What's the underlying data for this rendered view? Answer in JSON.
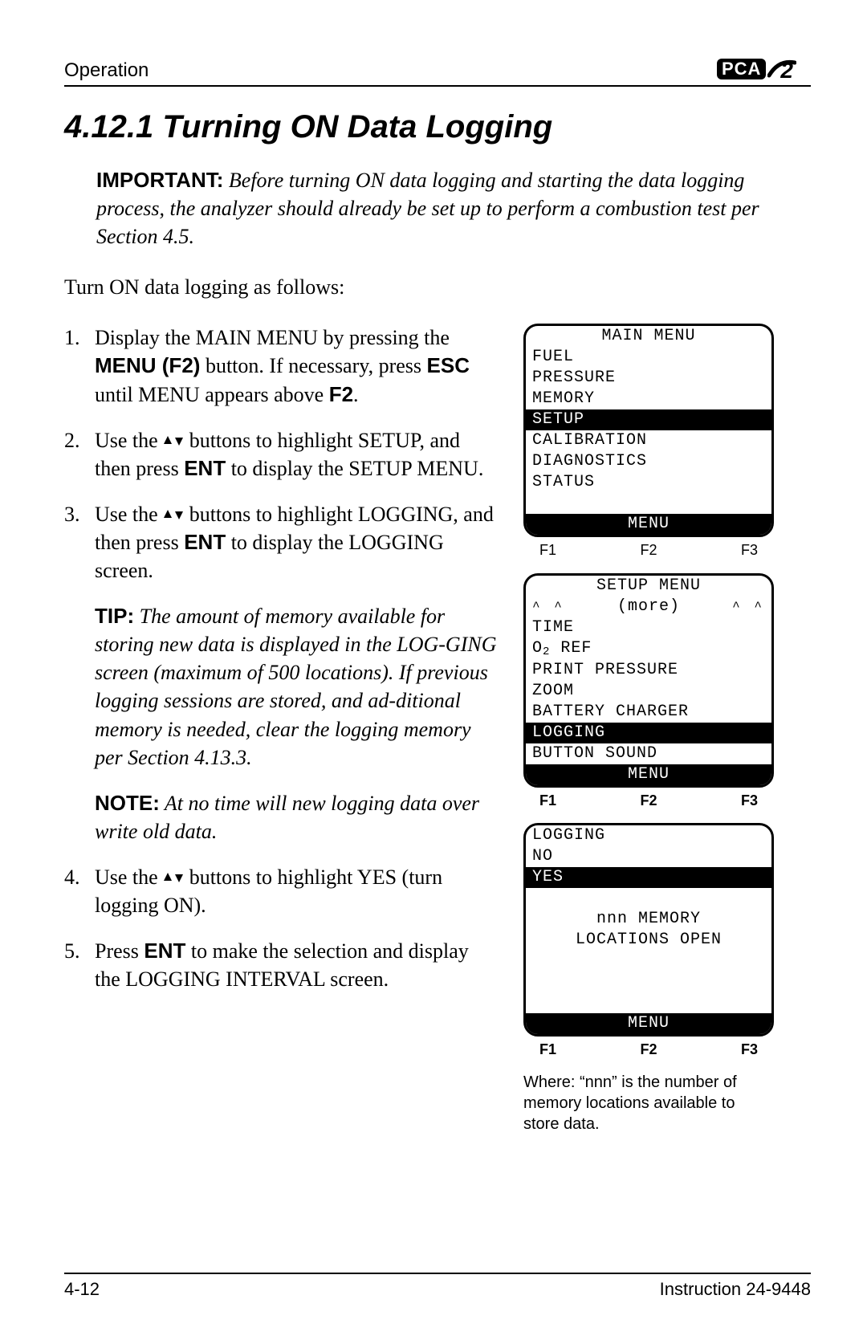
{
  "header": {
    "section": "Operation",
    "logo": "PCA",
    "logo2": "2"
  },
  "title": "4.12.1  Turning ON Data Logging",
  "important": {
    "prefix": "IMPORTANT:",
    "text": " Before turning ON data logging and starting the data logging process, the analyzer should already be set up to perform a combustion test per Section 4.5."
  },
  "intro": "Turn ON data logging as follows:",
  "steps": {
    "s1": {
      "n": "1.",
      "a": "Display the MAIN MENU by pressing the ",
      "b": "MENU (F2)",
      "c": " button. If necessary, press ",
      "d": "ESC",
      "e": " until MENU appears above ",
      "f": "F2",
      "g": "."
    },
    "s2": {
      "n": "2.",
      "a": "Use the ",
      "b": " buttons to highlight SETUP, and then press ",
      "c": "ENT",
      "d": " to display the SETUP MENU."
    },
    "s3": {
      "n": "3.",
      "a": "Use the ",
      "b": " buttons to highlight LOGGING, and then press ",
      "c": "ENT",
      "d": " to display the LOGGING screen."
    },
    "tip": {
      "prefix": "TIP:",
      "text": " The amount of memory available for storing new data is displayed in the LOG-GING screen (maximum of 500 locations). If previous logging sessions are stored, and ad-ditional memory is needed, clear the logging memory per Section 4.13.3."
    },
    "note": {
      "prefix": "NOTE:",
      "text": " At no time will new logging data over write old data."
    },
    "s4": {
      "n": "4.",
      "a": "Use the ",
      "b": " buttons to highlight YES (turn logging ON)."
    },
    "s5": {
      "n": "5.",
      "a": "Press ",
      "b": "ENT",
      "c": " to make the selection and display the LOGGING INTERVAL screen."
    }
  },
  "screens": {
    "s1": {
      "title": "MAIN MENU",
      "rows": [
        "FUEL",
        "PRESSURE",
        "MEMORY"
      ],
      "sel": "SETUP",
      "rows2": [
        "CALIBRATION",
        "DIAGNOSTICS",
        "STATUS"
      ],
      "bar": "MENU",
      "f1": "F1",
      "f2": "F2",
      "f3": "F3"
    },
    "s2": {
      "title": "SETUP MENU",
      "more": "(more)",
      "rows": [
        "TIME"
      ],
      "o2": "O",
      "o2sub": "2",
      "o2b": " REF",
      "rows2": [
        "PRINT PRESSURE",
        "ZOOM",
        "BATTERY CHARGER"
      ],
      "sel": "LOGGING",
      "rows3": [
        "BUTTON SOUND"
      ],
      "bar": "MENU",
      "f1": "F1",
      "f2": "F2",
      "f3": "F3"
    },
    "s3": {
      "title": "LOGGING",
      "rows": [
        "NO"
      ],
      "sel": "YES",
      "mem1": "nnn MEMORY",
      "mem2": "LOCATIONS OPEN",
      "bar": "MENU",
      "f1": "F1",
      "f2": "F2",
      "f3": "F3"
    },
    "caption": "Where: “nnn” is the number of memory locations available to store data."
  },
  "footer": {
    "left": "4-12",
    "right": "Instruction 24-9448"
  }
}
